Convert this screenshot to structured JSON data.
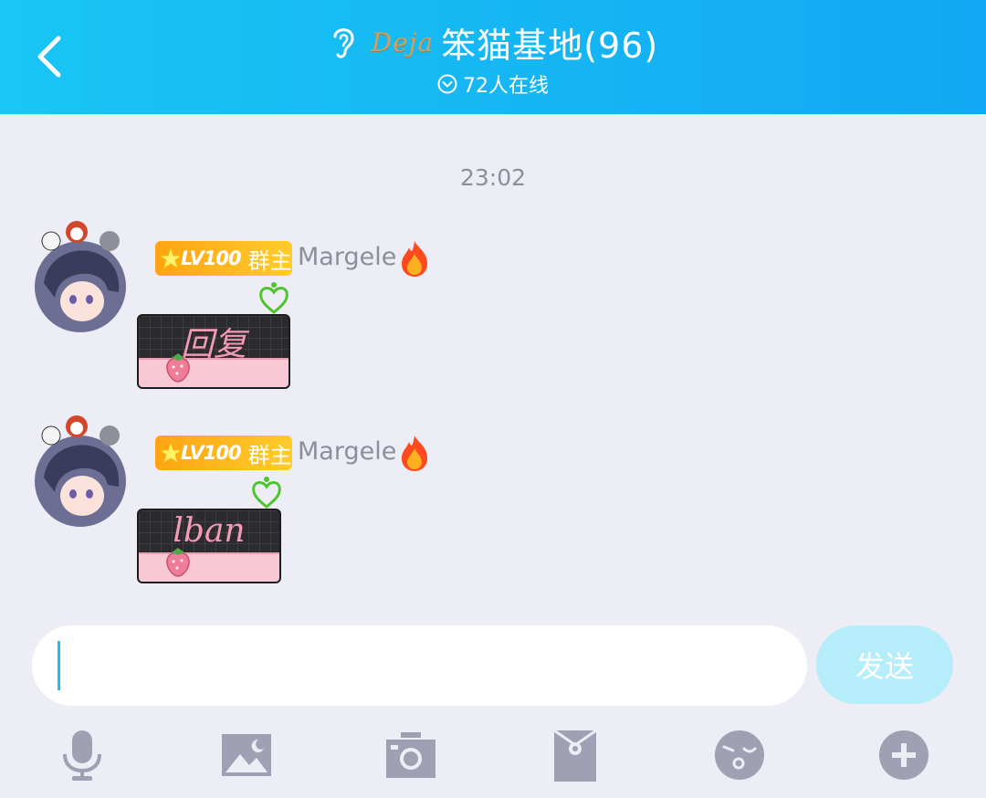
{
  "header": {
    "logo_text": "Deja",
    "title": "笨猫基地(96)",
    "online": "72人在线"
  },
  "chat": {
    "timestamp": "23:02",
    "messages": [
      {
        "badge_level": "LV100",
        "badge_role": "群主",
        "sender": "Margele",
        "sticker_text": "回复"
      },
      {
        "badge_level": "LV100",
        "badge_role": "群主",
        "sender": "Margele",
        "sticker_text": "lban"
      }
    ]
  },
  "input": {
    "value": "",
    "send_label": "发送"
  },
  "colors": {
    "header_start": "#19c6f4",
    "header_end": "#12a8f3",
    "badge": "#ffa413",
    "send_button": "#b5eefa",
    "toolbar_icon": "#a0a0b4"
  },
  "toolbar": {
    "icons": [
      "microphone-icon",
      "image-icon",
      "camera-icon",
      "red-packet-icon",
      "emoji-icon",
      "plus-icon"
    ]
  }
}
